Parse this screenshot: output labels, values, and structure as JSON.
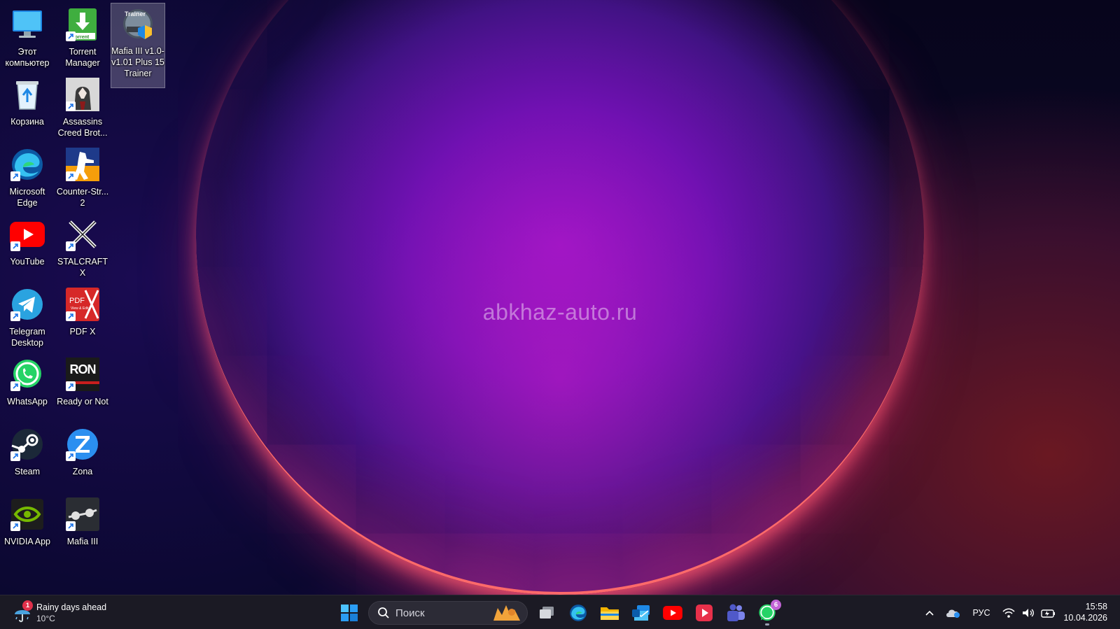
{
  "desktop": {
    "watermark": "abkhaz-auto.ru",
    "icons": [
      {
        "label": "Этот компьютер",
        "icon": "computer-icon"
      },
      {
        "label": "Torrent Manager",
        "icon": "torrent-icon"
      },
      {
        "label": "Mafia III v1.0-v1.01 Plus 15 Trainer",
        "icon": "trainer-icon",
        "selected": true
      },
      {
        "label": "Корзина",
        "icon": "recycle-bin-icon"
      },
      {
        "label": "Assassins Creed Brot...",
        "icon": "assassins-creed-icon"
      },
      {
        "label": "Microsoft Edge",
        "icon": "edge-icon"
      },
      {
        "label": "Counter-Str... 2",
        "icon": "counter-strike-icon"
      },
      {
        "label": "YouTube",
        "icon": "youtube-icon"
      },
      {
        "label": "STALCRAFT X",
        "icon": "stalcraft-icon"
      },
      {
        "label": "Telegram Desktop",
        "icon": "telegram-icon"
      },
      {
        "label": "PDF X",
        "icon": "pdf-icon"
      },
      {
        "label": "WhatsApp",
        "icon": "whatsapp-icon"
      },
      {
        "label": "Ready or Not",
        "icon": "ready-or-not-icon"
      },
      {
        "label": "Steam",
        "icon": "steam-icon"
      },
      {
        "label": "Zona",
        "icon": "zona-icon"
      },
      {
        "label": "NVIDIA App",
        "icon": "nvidia-icon"
      },
      {
        "label": "Mafia III",
        "icon": "mafia-icon"
      }
    ],
    "icon_text": {
      "torrent_badge": "orrent",
      "pdf_text": "PDF",
      "pdf_sub": "View & Edit",
      "ron_text": "RON",
      "trainer_text": "Trainer"
    }
  },
  "taskbar": {
    "weather": {
      "title": "Rainy days ahead",
      "temp": "10°C",
      "badge": "1"
    },
    "search_placeholder": "Поиск",
    "whatsapp_badge": "6",
    "language": "РУС",
    "time": "15:58",
    "date": "10.04.2026"
  },
  "colors": {
    "taskbar_bg": "#1b1a24",
    "accent_blue": "#2b8ff0",
    "badge_red": "#e0304a",
    "whatsapp_green": "#25d366"
  }
}
